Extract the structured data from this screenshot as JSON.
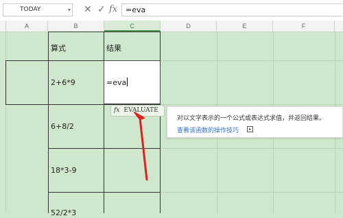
{
  "formula_bar": {
    "name_box": "TODAY",
    "cancel_symbol": "✕",
    "confirm_symbol": "✓",
    "fx_label": "fx",
    "formula_value": "=eva"
  },
  "columns": [
    "A",
    "B",
    "C",
    "D",
    "E",
    "F"
  ],
  "active_column": "C",
  "cells": {
    "B1": "算式",
    "C1": "结果",
    "B2": "2+6*9",
    "C2": "=eva",
    "B3": "6+8/2",
    "B4": "18*3-9",
    "B5": "52/2*3"
  },
  "autocomplete": {
    "fx_label": "fx",
    "suggestion": "EVALUATE"
  },
  "tooltip": {
    "description": "对以文字表示的一个公式或表达式求值，并返回结果。",
    "link": "查看该函数的操作技巧"
  },
  "colors": {
    "sheet_background": "#cfe7cc",
    "annotation_arrow": "#e0201c",
    "link": "#2f6fcf"
  }
}
